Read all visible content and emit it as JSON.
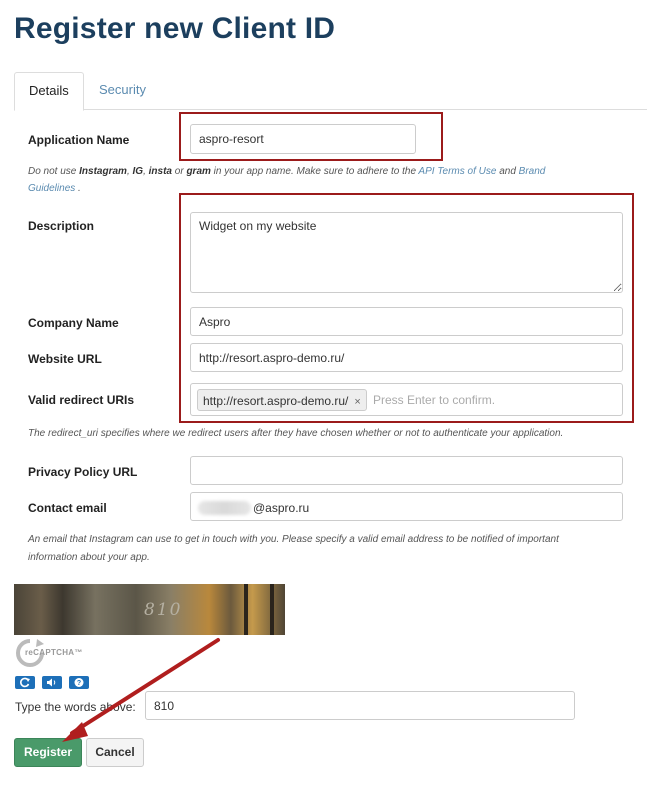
{
  "page": {
    "title": "Register new Client ID"
  },
  "tabs": {
    "details": "Details",
    "security": "Security"
  },
  "form": {
    "application_name": {
      "label": "Application Name",
      "value": "aspro-resort"
    },
    "app_name_hint": {
      "t1": "Do not use ",
      "b1": "Instagram",
      "t2": ", ",
      "b2": "IG",
      "t3": ", ",
      "b3": "insta",
      "t4": " or ",
      "b4": "gram",
      "t5": " in your app name. Make sure to adhere to the ",
      "link1": "API Terms of Use",
      "t6": " and ",
      "link2a": "Brand",
      "link2b": "Guidelines",
      "t7": " ."
    },
    "description": {
      "label": "Description",
      "value": "Widget on my website"
    },
    "company_name": {
      "label": "Company Name",
      "value": "Aspro"
    },
    "website_url": {
      "label": "Website URL",
      "value": "http://resort.aspro-demo.ru/"
    },
    "redirect_uris": {
      "label": "Valid redirect URIs",
      "tag": "http://resort.aspro-demo.ru/",
      "remove": "×",
      "placeholder": "Press Enter to confirm."
    },
    "redirect_hint": "The redirect_uri specifies where we redirect users after they have chosen whether or not to authenticate your application.",
    "privacy_policy_url": {
      "label": "Privacy Policy URL",
      "value": ""
    },
    "contact_email": {
      "label": "Contact email",
      "value_visible": "@aspro.ru"
    },
    "email_hint_line1": "An email that Instagram can use to get in touch with you. Please specify a valid email address to be notified of important",
    "email_hint_line2": "information about your app."
  },
  "captcha": {
    "image_word": "810",
    "brand": "reCAPTCHA™",
    "refresh_icon": "refresh-icon",
    "audio_icon": "audio-icon",
    "help_icon": "help-icon",
    "prompt": "Type the words above:",
    "answer": "810"
  },
  "actions": {
    "register": "Register",
    "cancel": "Cancel"
  },
  "colors": {
    "title": "#1c3f5e",
    "annotation_red": "#9b1b1b",
    "register_green": "#4a9a6a",
    "link": "#5b8bb0"
  }
}
